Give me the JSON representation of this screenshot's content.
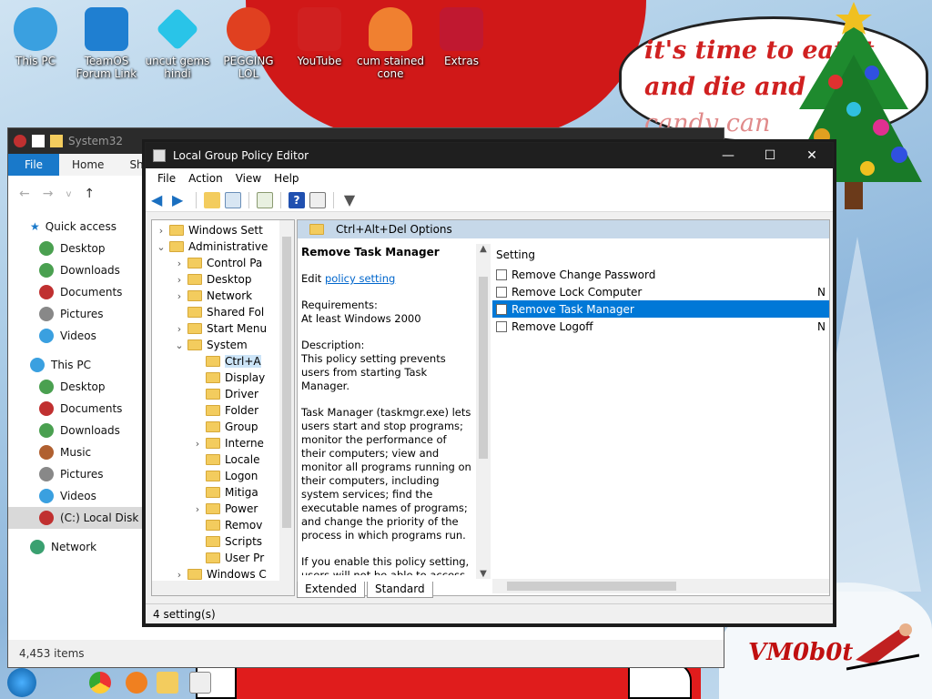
{
  "wallpaper": {
    "bubble_lines": [
      "it's time to eat it",
      "and die and g",
      "candy can"
    ],
    "signature": "VM0b0t"
  },
  "desktop_icons": [
    {
      "label": "This PC",
      "icon": "computer-icon",
      "color": "#3aa0e0"
    },
    {
      "label": "TeamOS Forum Link",
      "icon": "gear-icon",
      "color": "#1f7fd1"
    },
    {
      "label": "uncut gems hindi",
      "icon": "gem-icon",
      "color": "#29c4e8"
    },
    {
      "label": "PEGGING LOL",
      "icon": "letter-p-icon",
      "color": "#e04020"
    },
    {
      "label": "YouTube",
      "icon": "angry-bird-icon",
      "color": "#d02020"
    },
    {
      "label": "cum stained cone",
      "icon": "cone-icon",
      "color": "#f08030"
    },
    {
      "label": "Extras",
      "icon": "gift-icon",
      "color": "#c01830"
    }
  ],
  "explorer": {
    "title": "System32",
    "ribbon_tabs": [
      "File",
      "Home",
      "Share"
    ],
    "quick_access": "Quick access",
    "qa_items": [
      "Desktop",
      "Downloads",
      "Documents",
      "Pictures",
      "Videos"
    ],
    "this_pc": "This PC",
    "pc_items": [
      "Desktop",
      "Documents",
      "Downloads",
      "Music",
      "Pictures",
      "Videos",
      "(C:) Local Disk"
    ],
    "network": "Network",
    "status": "4,453 items"
  },
  "gpedit": {
    "title": "Local Group Policy Editor",
    "menu": [
      "File",
      "Action",
      "View",
      "Help"
    ],
    "tree": [
      {
        "label": "Windows Sett",
        "level": 1,
        "chev": ">"
      },
      {
        "label": "Administrative",
        "level": 1,
        "chev": "v"
      },
      {
        "label": "Control Pa",
        "level": 2,
        "chev": ">"
      },
      {
        "label": "Desktop",
        "level": 2,
        "chev": ">"
      },
      {
        "label": "Network",
        "level": 2,
        "chev": ">"
      },
      {
        "label": "Shared Fol",
        "level": 2,
        "chev": ""
      },
      {
        "label": "Start Menu",
        "level": 2,
        "chev": ">"
      },
      {
        "label": "System",
        "level": 2,
        "chev": "v"
      },
      {
        "label": "Ctrl+A",
        "level": 3,
        "chev": "",
        "selected": true
      },
      {
        "label": "Display",
        "level": 3,
        "chev": ""
      },
      {
        "label": "Driver",
        "level": 3,
        "chev": ""
      },
      {
        "label": "Folder",
        "level": 3,
        "chev": ""
      },
      {
        "label": "Group",
        "level": 3,
        "chev": ""
      },
      {
        "label": "Interne",
        "level": 3,
        "chev": ">"
      },
      {
        "label": "Locale",
        "level": 3,
        "chev": ""
      },
      {
        "label": "Logon",
        "level": 3,
        "chev": ""
      },
      {
        "label": "Mitiga",
        "level": 3,
        "chev": ""
      },
      {
        "label": "Power",
        "level": 3,
        "chev": ">"
      },
      {
        "label": "Remov",
        "level": 3,
        "chev": ""
      },
      {
        "label": "Scripts",
        "level": 3,
        "chev": ""
      },
      {
        "label": "User Pr",
        "level": 3,
        "chev": ""
      },
      {
        "label": "Windows C",
        "level": 2,
        "chev": ">"
      }
    ],
    "folder_header": "Ctrl+Alt+Del Options",
    "policy_title": "Remove Task Manager",
    "edit_prefix": "Edit",
    "edit_link": "policy setting",
    "requirements_label": "Requirements:",
    "requirements_value": "At least Windows 2000",
    "description_label": "Description:",
    "description_p1": "This policy setting prevents users from starting Task Manager.",
    "description_p2": "Task Manager (taskmgr.exe) lets users start and stop programs; monitor the performance of their computers; view and monitor all programs running on their computers, including system services; find the executable names of programs; and change the priority of the process in which programs run.",
    "description_p3": "If you enable this policy setting, users will not be able to access",
    "column_setting": "Setting",
    "settings": [
      {
        "name": "Remove Change Password",
        "state": ""
      },
      {
        "name": "Remove Lock Computer",
        "state": "N"
      },
      {
        "name": "Remove Task Manager",
        "state": "",
        "selected": true
      },
      {
        "name": "Remove Logoff",
        "state": "N"
      }
    ],
    "tabs": [
      "Extended",
      "Standard"
    ],
    "status": "4 setting(s)"
  }
}
